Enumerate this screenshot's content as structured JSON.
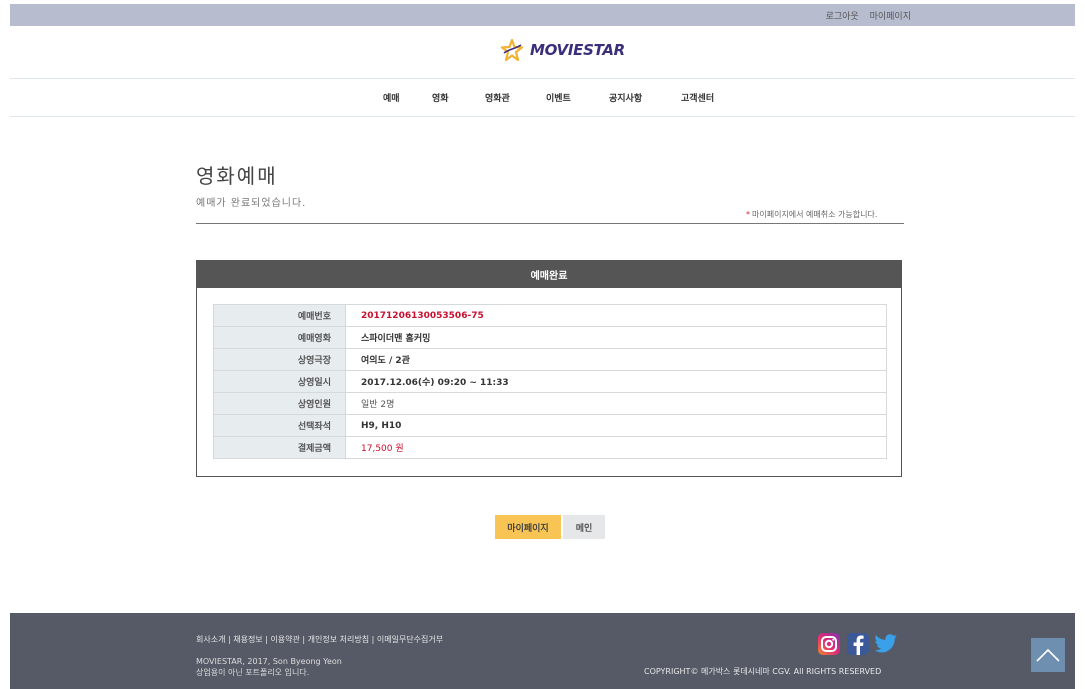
{
  "topbar": {
    "logout": "로그아웃",
    "mypage": "마이페이지"
  },
  "brand": {
    "name": "MOVIESTAR",
    "accent": "#f2b233",
    "text_color": "#3a2f7a"
  },
  "nav": {
    "items": [
      "예매",
      "영화",
      "영화관",
      "이벤트",
      "공지사항",
      "고객센터"
    ]
  },
  "page": {
    "title": "영화예매",
    "subtitle": "예매가 완료되었습니다.",
    "notice": "마이페이지에서 예매취소 가능합니다.",
    "notice_mark": "*"
  },
  "card": {
    "title": "예매완료",
    "rows": [
      {
        "label": "예매번호",
        "value": "20171206130053506-75"
      },
      {
        "label": "예매영화",
        "value": "스파이더맨 홈커밍"
      },
      {
        "label": "상영극장",
        "value": "여의도 / 2관"
      },
      {
        "label": "상영일시",
        "value": "2017.12.06(수) 09:20 ~ 11:33"
      },
      {
        "label": "상영인원",
        "value": "일반 2명"
      },
      {
        "label": "선택좌석",
        "value": "H9, H10"
      },
      {
        "label": "결제금액",
        "value": "17,500 원"
      }
    ]
  },
  "buttons": {
    "mypage": "마이페이지",
    "main": "메인"
  },
  "footer": {
    "links": "회사소개 | 채용정보 | 이용약관 | 개인정보 처리방침 | 이메일무단수집거부",
    "line1": "MOVIESTAR, 2017, Son Byeong Yeon",
    "line2": "상업용이 아닌 포트폴리오 입니다.",
    "rights": "COPYRIGHT© 메가박스 롯데시네마 CGV. All RIGHTS RESERVED",
    "social_icons": [
      "instagram-icon",
      "facebook-icon",
      "twitter-icon"
    ],
    "scroll_top_icon": "chevron-up-icon"
  },
  "colors": {
    "accent_red": "#c8102e",
    "button_primary": "#f8c454",
    "card_header": "#555555",
    "footer_bg": "#555a66"
  }
}
